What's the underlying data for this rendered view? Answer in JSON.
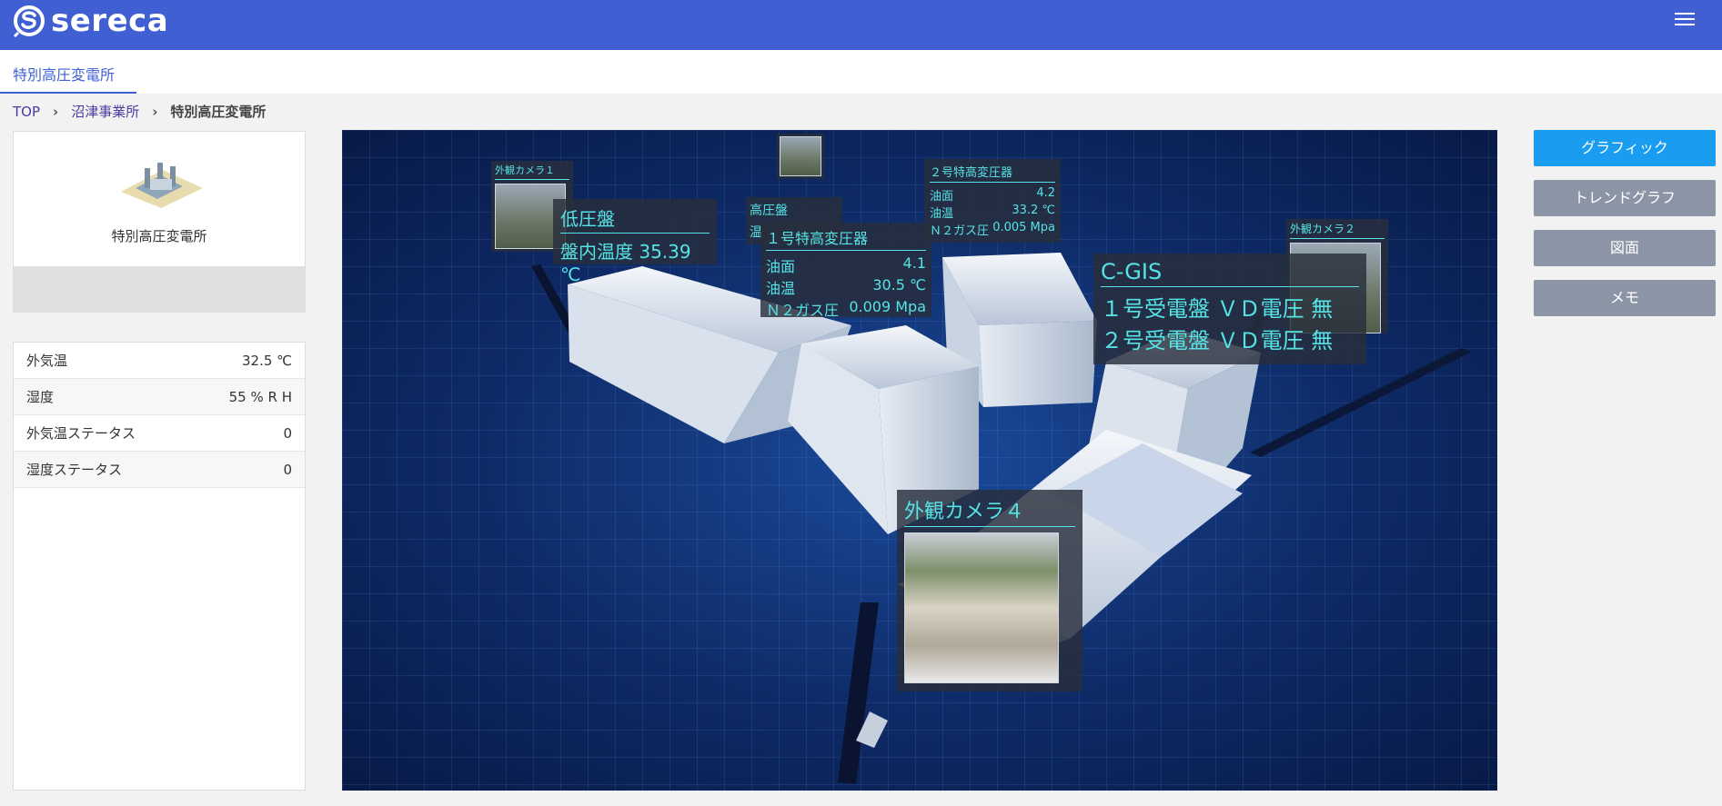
{
  "app": {
    "logo_text": "sereca"
  },
  "tab": {
    "label": "特別高圧変電所"
  },
  "breadcrumb": [
    {
      "label": "TOP"
    },
    {
      "label": "沼津事業所"
    },
    {
      "label": "特別高圧変電所"
    }
  ],
  "site": {
    "name": "特別高圧変電所"
  },
  "status": [
    {
      "label": "外気温",
      "value": "32.5 ℃"
    },
    {
      "label": "湿度",
      "value": "55 % R H"
    },
    {
      "label": "外気温ステータス",
      "value": "0"
    },
    {
      "label": "湿度ステータス",
      "value": "0"
    }
  ],
  "scene": {
    "camera1": {
      "title": "外観カメラ１"
    },
    "camera2": {
      "title": "外観カメラ２"
    },
    "camera4": {
      "title": "外観カメラ４"
    },
    "low_voltage": {
      "title": "低圧盤",
      "line1": "盤内温度 35.39 ℃"
    },
    "high_voltage": {
      "title": "高圧盤",
      "line1": "温"
    },
    "transformer1": {
      "title": "１号特高変圧器",
      "rows": [
        {
          "label": "油面",
          "value": "4.1"
        },
        {
          "label": "油温",
          "value": "30.5 ℃"
        },
        {
          "label": "Ｎ２ガス圧",
          "value": "0.009 Mpa"
        }
      ]
    },
    "transformer2": {
      "title": "２号特高変圧器",
      "rows": [
        {
          "label": "油面",
          "value": "4.2"
        },
        {
          "label": "油温",
          "value": "33.2 ℃"
        },
        {
          "label": "Ｎ２ガス圧",
          "value": "0.005 Mpa"
        }
      ]
    },
    "cgis": {
      "title": "C-GIS",
      "line1": "１号受電盤 ＶＤ電圧 無",
      "line2": "２号受電盤 ＶＤ電圧 無"
    }
  },
  "buttons": {
    "graphic": "グラフィック",
    "trend": "トレンドグラフ",
    "drawing": "図面",
    "memo": "メモ"
  },
  "colors": {
    "header": "#3f5fd3",
    "active_button": "#1a9cf0",
    "inactive_button": "#8b95a5",
    "tag_text": "#56e3e6"
  }
}
